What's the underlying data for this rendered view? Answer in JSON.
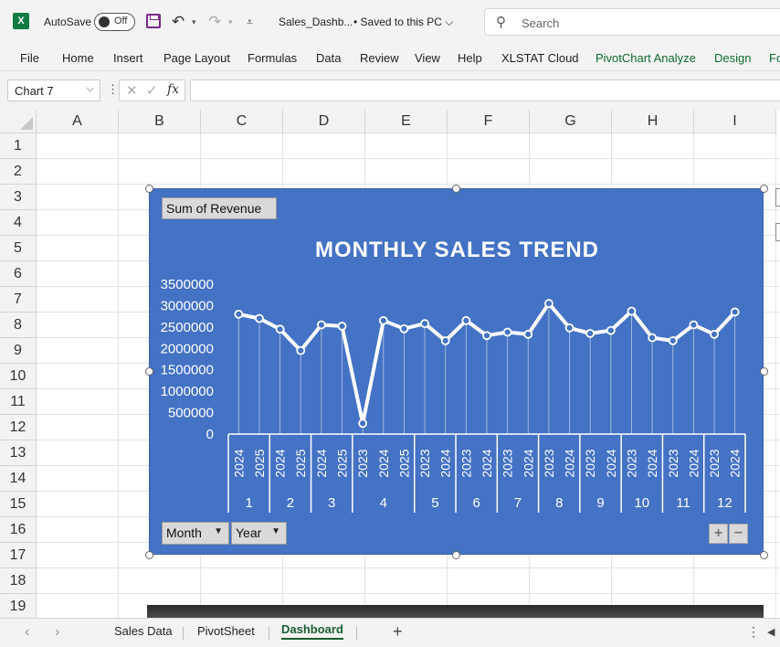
{
  "titlebar": {
    "logo": "X",
    "autosave_label": "AutoSave",
    "autosave_state": "Off",
    "filename": "Sales_Dashb...",
    "save_status": "• Saved to this PC ⌵",
    "search_placeholder": "Search",
    "icons": [
      "excel-logo",
      "save-icon",
      "undo-icon",
      "redo-icon",
      "customize-quick-access-icon",
      "search-icon"
    ]
  },
  "ribbon": {
    "tabs": [
      "File",
      "Home",
      "Insert",
      "Page Layout",
      "Formulas",
      "Data",
      "Review",
      "View",
      "Help",
      "XLSTAT Cloud",
      "PivotChart Analyze",
      "Design",
      "Fo"
    ],
    "contextual_tab_color": "#0f6b2e"
  },
  "formula_bar": {
    "name_box": "Chart 7",
    "formula": ""
  },
  "grid": {
    "columns": [
      "A",
      "B",
      "C",
      "D",
      "E",
      "F",
      "G",
      "H",
      "I"
    ],
    "rows": [
      "1",
      "2",
      "3",
      "4",
      "5",
      "6",
      "7",
      "8",
      "9",
      "10",
      "11",
      "12",
      "13",
      "14",
      "15",
      "16",
      "17",
      "18",
      "19"
    ]
  },
  "chart": {
    "background_color": "#4472c4",
    "value_field_button": "Sum of Revenue",
    "axis_field_buttons": [
      "Month",
      "Year"
    ],
    "expand_label": "+",
    "collapse_label": "−"
  },
  "chart_data": {
    "type": "line",
    "title": "MONTHLY SALES TREND",
    "xlabel": "",
    "ylabel": "",
    "ylim": [
      0,
      3500000
    ],
    "y_ticks": [
      "3500000",
      "3000000",
      "2500000",
      "2000000",
      "1500000",
      "1000000",
      "500000",
      "0"
    ],
    "grid": false,
    "legend": "none",
    "line_color": "#ffffff",
    "categories": [
      {
        "month": "1",
        "years": [
          "2024",
          "2025"
        ]
      },
      {
        "month": "2",
        "years": [
          "2024",
          "2025"
        ]
      },
      {
        "month": "3",
        "years": [
          "2024",
          "2025"
        ]
      },
      {
        "month": "4",
        "years": [
          "2023",
          "2024",
          "2025"
        ]
      },
      {
        "month": "5",
        "years": [
          "2023",
          "2024"
        ]
      },
      {
        "month": "6",
        "years": [
          "2023",
          "2024"
        ]
      },
      {
        "month": "7",
        "years": [
          "2023",
          "2024"
        ]
      },
      {
        "month": "8",
        "years": [
          "2023",
          "2024"
        ]
      },
      {
        "month": "9",
        "years": [
          "2023",
          "2024"
        ]
      },
      {
        "month": "10",
        "years": [
          "2023",
          "2024"
        ]
      },
      {
        "month": "11",
        "years": [
          "2023",
          "2024"
        ]
      },
      {
        "month": "12",
        "years": [
          "2023",
          "2024"
        ]
      }
    ],
    "values": [
      2800000,
      2700000,
      2450000,
      1950000,
      2550000,
      2520000,
      250000,
      2650000,
      2460000,
      2580000,
      2180000,
      2650000,
      2300000,
      2380000,
      2330000,
      3050000,
      2480000,
      2350000,
      2420000,
      2870000,
      2250000,
      2180000,
      2550000,
      2330000,
      2850000
    ]
  },
  "sheet_tabs": {
    "tabs": [
      "Sales Data",
      "PivotSheet",
      "Dashboard"
    ],
    "active": "Dashboard",
    "add_label": "+",
    "more_label": "⋮"
  }
}
